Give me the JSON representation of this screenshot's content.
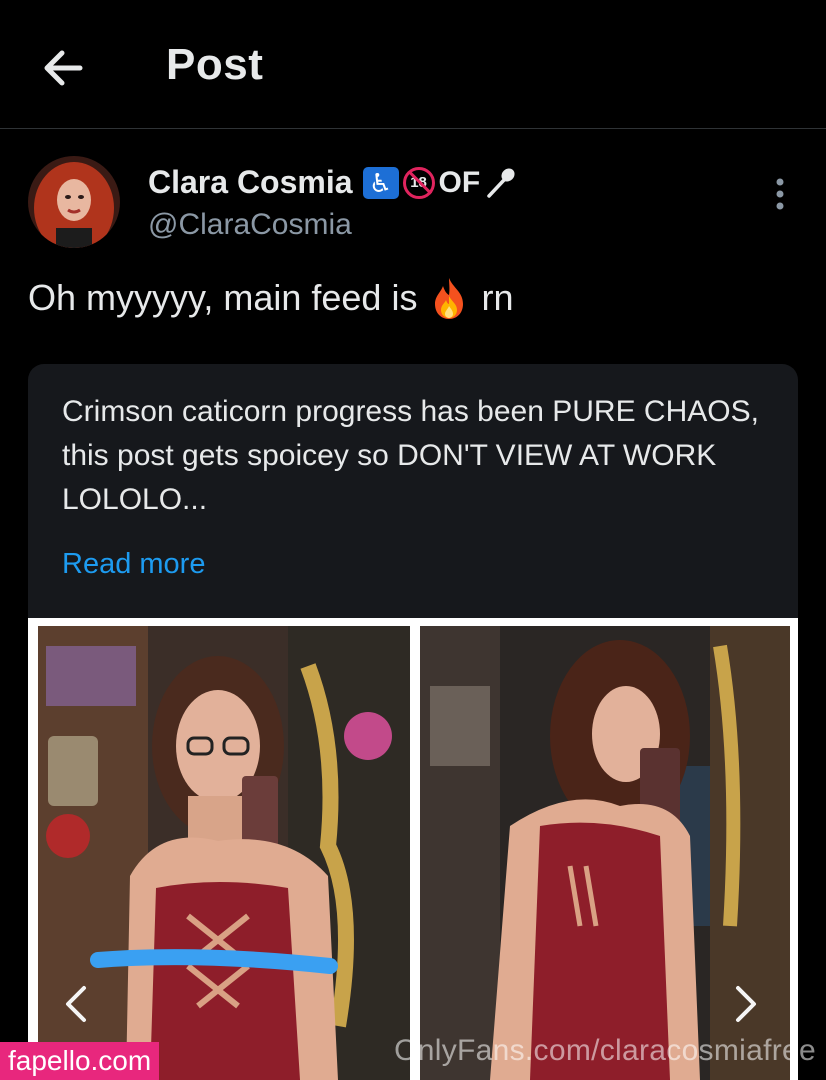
{
  "header": {
    "title": "Post"
  },
  "post": {
    "author": {
      "name": "Clara Cosmia",
      "badge_18": "18",
      "badge_text": "OF",
      "handle": "@ClaraCosmia"
    },
    "text": "Oh myyyyy, main feed is",
    "text_suffix": "rn"
  },
  "embed": {
    "text": "Crimson caticorn progress has been PURE CHAOS, this post gets spoicey so DON'T VIEW AT WORK LOLOLO...",
    "read_more": "Read more"
  },
  "watermarks": {
    "site": "fapello.com",
    "onlyfans": "OnlyFans.com/claracosmiafree"
  },
  "colors": {
    "background": "#000000",
    "link": "#1d9bf0",
    "muted": "#8b98a5",
    "card": "#16181c",
    "watermark_pink": "#e8277d"
  },
  "icons": [
    "back-arrow-icon",
    "accessibility-icon",
    "no-under-18-icon",
    "spoon-icon",
    "more-vertical-icon",
    "fire-emoji-icon",
    "chevron-left-icon",
    "chevron-right-icon"
  ]
}
